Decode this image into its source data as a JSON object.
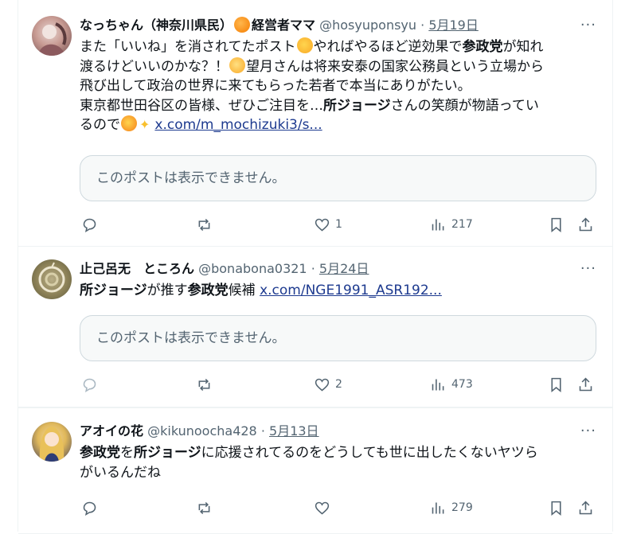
{
  "tweets": [
    {
      "name_a": "なっちゃん（神奈川県民）",
      "name_b": "経営者ママ",
      "handle": "@hosyuponsyu",
      "sep": "·",
      "date": "5月19日",
      "more": "···",
      "text": {
        "l1a": "また「いいね」を消されてたポスト",
        "l1b": "やればやるほど逆効果で",
        "l1c": "参政党",
        "l1d": "が知れ",
        "l2a": "渡るけどいいのかな？！",
        "l2b": "望月さんは将来安泰の国家公務員という立場から",
        "l3": "飛び出して政治の世界に来てもらった若者で本当にありがたい。",
        "l4a": "東京都世田谷区の皆様、ぜひご注目を…",
        "l4b": "所ジョージ",
        "l4c": "さんの笑顔が物語ってい",
        "l5a": "るので",
        "link": "x.com/m_mochizuki3/s..."
      },
      "unavailable": "このポストは表示できません。",
      "likes": "1",
      "views": "217"
    },
    {
      "name_a": "止己呂无　ところん",
      "handle": "@bonabona0321",
      "sep": "·",
      "date": "5月24日",
      "more": "···",
      "text": {
        "a": "所ジョージ",
        "b": "が推す",
        "c": "参政党",
        "d": "候補 ",
        "link": "x.com/NGE1991_ASR192..."
      },
      "unavailable": "このポストは表示できません。",
      "likes": "2",
      "views": "473"
    },
    {
      "name_a": "アオイの花",
      "handle": "@kikunoocha428",
      "sep": "·",
      "date": "5月13日",
      "more": "···",
      "text": {
        "a": "参政党",
        "b": "を",
        "c": "所ジョージ",
        "d": "に応援されてるのをどうしても世に出したくないヤツら",
        "e": "がいるんだね"
      },
      "likes": "",
      "views": "279"
    }
  ],
  "icons": {
    "reply": "reply-icon",
    "repost": "repost-icon",
    "like": "heart-icon",
    "views": "views-chart-icon",
    "bookmark": "bookmark-icon",
    "share": "share-icon",
    "emoji_orange": "orange-emoji",
    "emoji_sweat": "grinning-sweat-emoji",
    "emoji_thinking": "thinking-face-emoji",
    "emoji_laugh": "laughing-emoji",
    "emoji_sparkles": "sparkles-emoji"
  },
  "colors": {
    "text": "#0f1419",
    "muted": "#536471",
    "border": "#eff3f4",
    "link": "#1d3a8f",
    "card_bg": "#f7f9f9"
  }
}
